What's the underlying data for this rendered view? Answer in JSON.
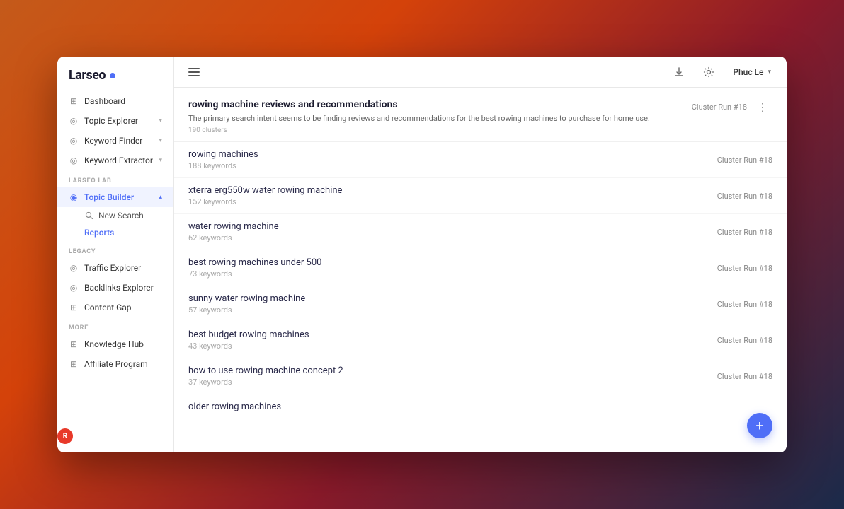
{
  "app": {
    "name": "Larseo"
  },
  "topbar": {
    "user_name": "Phuc Le",
    "download_icon": "⬇",
    "settings_icon": "⚙",
    "chevron_icon": "▾"
  },
  "sidebar": {
    "nav_items": [
      {
        "id": "dashboard",
        "label": "Dashboard",
        "icon": "⊞",
        "has_children": false,
        "active": false
      },
      {
        "id": "topic-explorer",
        "label": "Topic Explorer",
        "icon": "◎",
        "has_children": true,
        "active": false
      },
      {
        "id": "keyword-finder",
        "label": "Keyword Finder",
        "icon": "◎",
        "has_children": true,
        "active": false
      },
      {
        "id": "keyword-extractor",
        "label": "Keyword Extractor",
        "icon": "◎",
        "has_children": true,
        "active": false
      }
    ],
    "larseo_lab_label": "LARSEO LAB",
    "larseo_lab_items": [
      {
        "id": "topic-builder",
        "label": "Topic Builder",
        "icon": "◉",
        "has_children": true,
        "active": true
      }
    ],
    "topic_builder_sub": [
      {
        "id": "new-search",
        "label": "New Search",
        "icon": "search",
        "active": false
      },
      {
        "id": "reports",
        "label": "Reports",
        "active": true
      }
    ],
    "legacy_label": "LEGACY",
    "legacy_items": [
      {
        "id": "traffic-explorer",
        "label": "Traffic Explorer",
        "icon": "◎",
        "active": false
      },
      {
        "id": "backlinks-explorer",
        "label": "Backlinks Explorer",
        "icon": "◎",
        "active": false
      },
      {
        "id": "content-gap",
        "label": "Content Gap",
        "icon": "⊞",
        "active": false
      }
    ],
    "more_label": "MORE",
    "more_items": [
      {
        "id": "knowledge-hub",
        "label": "Knowledge Hub",
        "icon": "⊞",
        "active": false
      },
      {
        "id": "affiliate-program",
        "label": "Affiliate Program",
        "icon": "⊞",
        "active": false
      }
    ]
  },
  "main": {
    "header": {
      "title": "rowing machine reviews and recommendations",
      "description": "The primary search intent seems to be finding reviews and recommendations for the best rowing machines to purchase for home use.",
      "meta": "190 clusters",
      "badge": "Cluster Run #18"
    },
    "clusters": [
      {
        "title": "rowing machines",
        "keywords": "188 keywords",
        "badge": "Cluster Run #18"
      },
      {
        "title": "xterra erg550w water rowing machine",
        "keywords": "152 keywords",
        "badge": "Cluster Run #18"
      },
      {
        "title": "water rowing machine",
        "keywords": "62 keywords",
        "badge": "Cluster Run #18"
      },
      {
        "title": "best rowing machines under 500",
        "keywords": "73 keywords",
        "badge": "Cluster Run #18"
      },
      {
        "title": "sunny water rowing machine",
        "keywords": "57 keywords",
        "badge": "Cluster Run #18"
      },
      {
        "title": "best budget rowing machines",
        "keywords": "43 keywords",
        "badge": "Cluster Run #18"
      },
      {
        "title": "how to use rowing machine concept 2",
        "keywords": "37 keywords",
        "badge": "Cluster Run #18"
      },
      {
        "title": "older rowing machines",
        "keywords": "",
        "badge": ""
      }
    ],
    "fab_label": "+"
  }
}
